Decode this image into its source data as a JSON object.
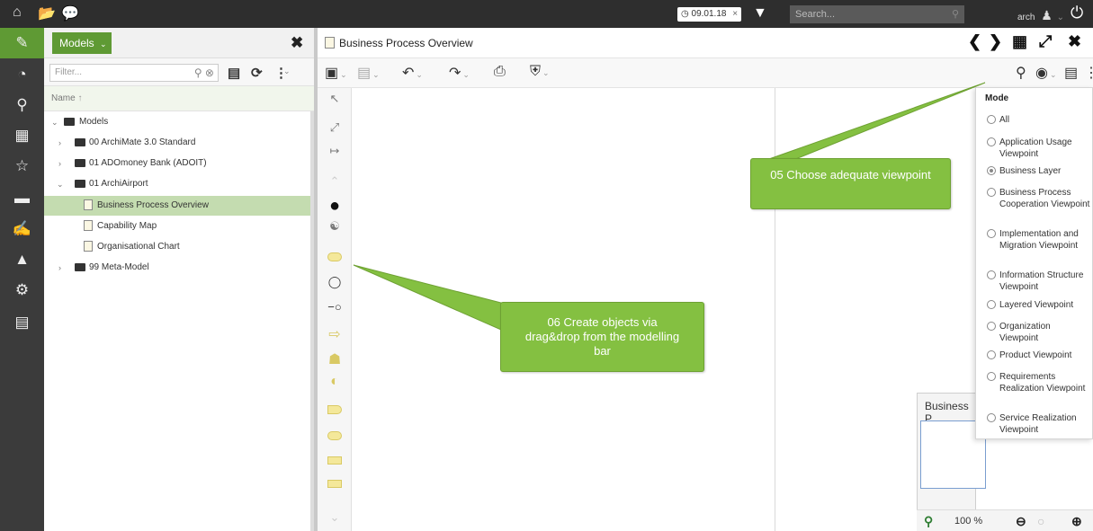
{
  "topbar": {
    "date_chip": "09.01.18",
    "search_placeholder": "Search...",
    "user_name": "arch"
  },
  "panel": {
    "models_button": "Models",
    "filter_placeholder": "Filter...",
    "column_header": "Name",
    "tree": [
      {
        "label": "Models",
        "kind": "folder-open",
        "level": 0,
        "expanded": true
      },
      {
        "label": "00 ArchiMate 3.0 Standard",
        "kind": "folder",
        "level": 1,
        "expanded": false
      },
      {
        "label": "01 ADOmoney Bank (ADOIT)",
        "kind": "folder",
        "level": 1,
        "expanded": false
      },
      {
        "label": "01 ArchiAirport",
        "kind": "folder-open",
        "level": 1,
        "expanded": true
      },
      {
        "label": "Business Process Overview",
        "kind": "model",
        "level": 2,
        "selected": true
      },
      {
        "label": "Capability Map",
        "kind": "model",
        "level": 2
      },
      {
        "label": "Organisational Chart",
        "kind": "model",
        "level": 2
      },
      {
        "label": "99 Meta-Model",
        "kind": "folder",
        "level": 1,
        "expanded": false
      }
    ]
  },
  "main": {
    "title": "Business Process Overview"
  },
  "callouts": {
    "viewpoint": "05 Choose adequate viewpoint",
    "objects": "06 Create objects via drag&drop from the modelling bar"
  },
  "mode_menu": {
    "title": "Mode",
    "options": [
      {
        "label": "All",
        "selected": false
      },
      {
        "label": "Application Usage Viewpoint",
        "selected": false
      },
      {
        "label": "Business Layer",
        "selected": true
      },
      {
        "label": "Business Process Cooperation Viewpoint",
        "selected": false
      },
      {
        "label": "Implementation and Migration Viewpoint",
        "selected": false
      },
      {
        "label": "Information Structure Viewpoint",
        "selected": false
      },
      {
        "label": "Layered Viewpoint",
        "selected": false
      },
      {
        "label": "Organization Viewpoint",
        "selected": false
      },
      {
        "label": "Product Viewpoint",
        "selected": false
      },
      {
        "label": "Requirements Realization Viewpoint",
        "selected": false
      },
      {
        "label": "Service Realization Viewpoint",
        "selected": false
      }
    ]
  },
  "minimap": {
    "title": "Business P",
    "zoom": "100 %"
  },
  "colors": {
    "accent_green": "#5f9a34",
    "callout_green": "#84c041",
    "selection_green": "#c4dcb0"
  }
}
